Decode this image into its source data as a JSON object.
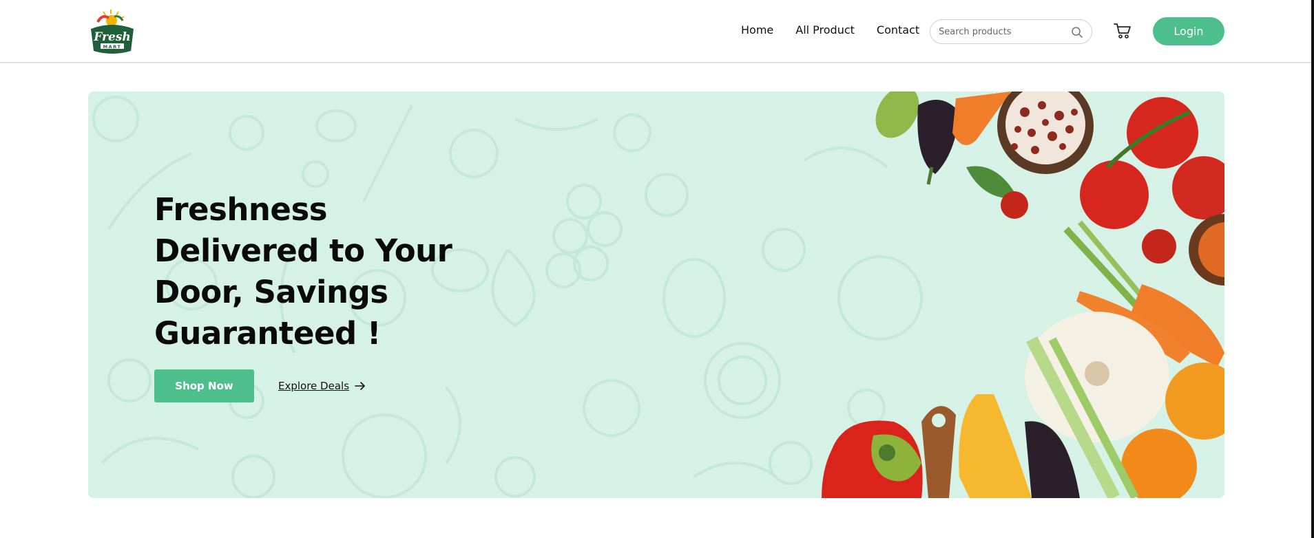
{
  "header": {
    "logo": {
      "text": "Fresh",
      "subtext": "MART",
      "icon": "logo-sun-leaf-icon"
    },
    "nav": [
      {
        "label": "Home"
      },
      {
        "label": "All Product"
      },
      {
        "label": "Contact"
      }
    ],
    "search": {
      "placeholder": "Search products",
      "value": "",
      "icon": "search-icon"
    },
    "cart": {
      "icon": "cart-icon"
    },
    "login_label": "Login"
  },
  "hero": {
    "headline_lines": [
      "Freshness",
      "Delivered to Your",
      "Door, Savings",
      "Guaranteed !"
    ],
    "shop_now_label": "Shop Now",
    "explore_label": "Explore Deals",
    "explore_icon": "arrow-right-icon",
    "image": "vegetables-image"
  },
  "colors": {
    "accent": "#4cbf8c",
    "hero_bg": "#d6f2e6",
    "text": "#0a0a0a"
  }
}
